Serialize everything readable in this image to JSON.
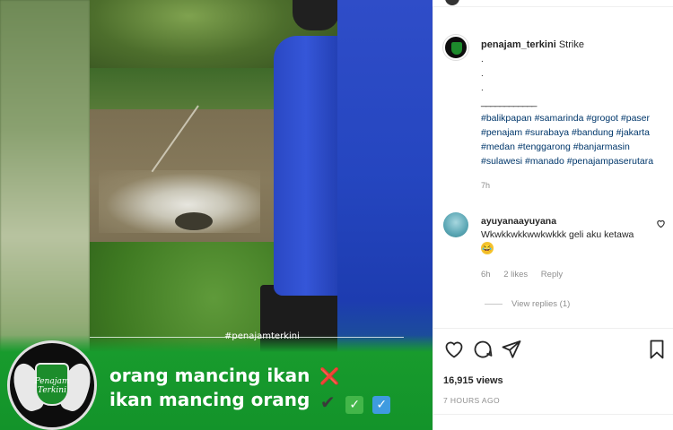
{
  "video": {
    "watermark": "#penajamterkini",
    "logo_text": "Penajam Terkini",
    "line1": "orang mancing ikan",
    "line2": "ikan mancing orang",
    "mark_x": "❌",
    "mark_checks": [
      "✔",
      "✓",
      "✓"
    ]
  },
  "post": {
    "username": "penajam_terkini",
    "caption": "Strike",
    "dots": [
      ".",
      ".",
      "."
    ],
    "underline": "____________",
    "hashtags": [
      "#balikpapan",
      "#samarinda",
      "#grogot",
      "#paser",
      "#penajam",
      "#surabaya",
      "#bandung",
      "#jakarta",
      "#medan",
      "#tenggarong",
      "#banjarmasin",
      "#sulawesi",
      "#manado",
      "#penajampaserutara"
    ],
    "time": "7h"
  },
  "comment": {
    "username": "ayuyanaayuyana",
    "text": "Wkwkkwkkwwkwkkk geli aku ketawa",
    "emoji": "😂",
    "time": "6h",
    "likes": "2 likes",
    "reply": "Reply",
    "view_replies": "View replies (1)"
  },
  "stats": {
    "views": "16,915 views",
    "ago": "7 HOURS AGO"
  },
  "icons": [
    "heart-icon",
    "comment-icon",
    "share-icon",
    "bookmark-icon"
  ]
}
